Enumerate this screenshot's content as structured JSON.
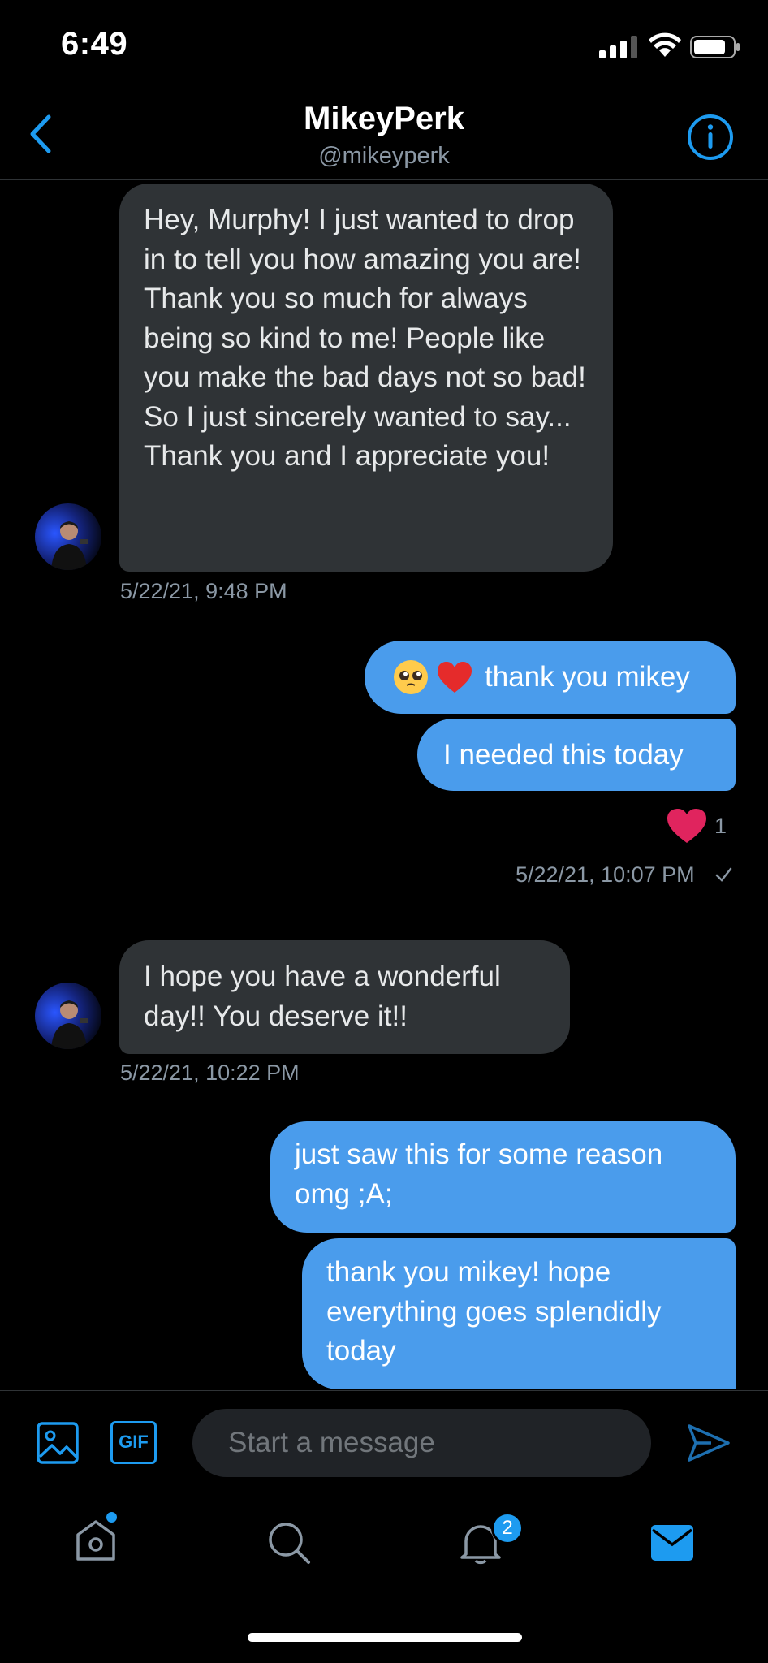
{
  "status_bar": {
    "time": "6:49"
  },
  "header": {
    "name": "MikeyPerk",
    "handle": "@mikeyperk"
  },
  "messages": [
    {
      "text": "Hey, Murphy! I just wanted to drop in to tell you how amazing you are! Thank you so much for always being so kind to me! People like you make the bad days not so bad! So I just sincerely wanted to say... Thank you and I appreciate you!",
      "timestamp": "5/22/21, 9:48 PM"
    },
    {
      "text": "thank you mikey"
    },
    {
      "text": "I needed this today"
    },
    {
      "reaction_count": "1",
      "timestamp": "5/22/21, 10:07 PM"
    },
    {
      "text": "I hope you have a wonderful day!! You deserve it!!",
      "timestamp": "5/22/21, 10:22 PM"
    },
    {
      "text": "just saw this for some reason omg ;A;"
    },
    {
      "text": "thank you mikey! hope everything goes splendidly today"
    }
  ],
  "compose": {
    "placeholder": "Start a message",
    "gif_label": "GIF"
  },
  "tab_bar": {
    "notifications_badge": "2"
  },
  "colors": {
    "accent": "#1d9bf0",
    "outgoing_bubble": "#4a9cec",
    "incoming_bubble": "#2f3336",
    "heart": "#e0245e"
  }
}
